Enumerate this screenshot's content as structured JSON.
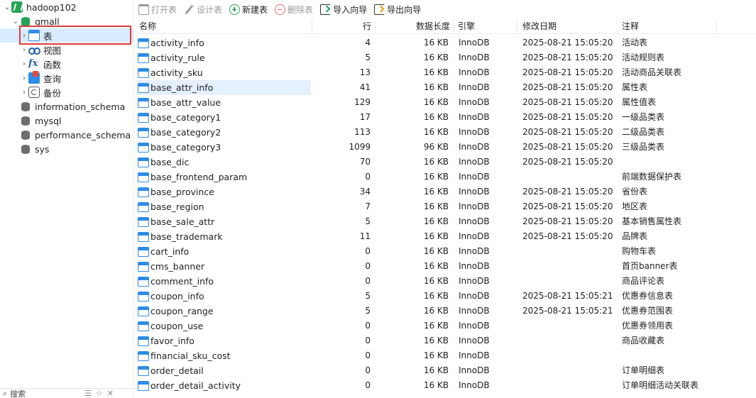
{
  "sidebar": {
    "connection": "hadoop102",
    "database": "gmall",
    "items": [
      {
        "label": "表",
        "icon": "table-icon"
      },
      {
        "label": "视图",
        "icon": "view-icon"
      },
      {
        "label": "函数",
        "icon": "function-icon"
      },
      {
        "label": "查询",
        "icon": "query-icon"
      },
      {
        "label": "备份",
        "icon": "backup-icon"
      }
    ],
    "other_databases": [
      "information_schema",
      "mysql",
      "performance_schema",
      "sys"
    ],
    "search_label": "搜索"
  },
  "toolbar": {
    "open_table": "打开表",
    "design_table": "设计表",
    "new_table": "新建表",
    "delete_table": "删除表",
    "import_wizard": "导入向导",
    "export_wizard": "导出向导"
  },
  "table": {
    "columns": [
      "名称",
      "行",
      "数据长度",
      "引擎",
      "修改日期",
      "注释"
    ],
    "rows": [
      {
        "name": "activity_info",
        "rows": "4",
        "size": "16 KB",
        "engine": "InnoDB",
        "modified": "2025-08-21 15:05:20",
        "comment": "活动表"
      },
      {
        "name": "activity_rule",
        "rows": "5",
        "size": "16 KB",
        "engine": "InnoDB",
        "modified": "2025-08-21 15:05:20",
        "comment": "活动规则表"
      },
      {
        "name": "activity_sku",
        "rows": "13",
        "size": "16 KB",
        "engine": "InnoDB",
        "modified": "2025-08-21 15:05:20",
        "comment": "活动商品关联表"
      },
      {
        "name": "base_attr_info",
        "rows": "41",
        "size": "16 KB",
        "engine": "InnoDB",
        "modified": "2025-08-21 15:05:20",
        "comment": "属性表"
      },
      {
        "name": "base_attr_value",
        "rows": "129",
        "size": "16 KB",
        "engine": "InnoDB",
        "modified": "2025-08-21 15:05:20",
        "comment": "属性值表"
      },
      {
        "name": "base_category1",
        "rows": "17",
        "size": "16 KB",
        "engine": "InnoDB",
        "modified": "2025-08-21 15:05:20",
        "comment": "一级品类表"
      },
      {
        "name": "base_category2",
        "rows": "113",
        "size": "16 KB",
        "engine": "InnoDB",
        "modified": "2025-08-21 15:05:20",
        "comment": "二级品类表"
      },
      {
        "name": "base_category3",
        "rows": "1099",
        "size": "96 KB",
        "engine": "InnoDB",
        "modified": "2025-08-21 15:05:20",
        "comment": "三级品类表"
      },
      {
        "name": "base_dic",
        "rows": "70",
        "size": "16 KB",
        "engine": "InnoDB",
        "modified": "2025-08-21 15:05:20",
        "comment": ""
      },
      {
        "name": "base_frontend_param",
        "rows": "0",
        "size": "16 KB",
        "engine": "InnoDB",
        "modified": "",
        "comment": "前端数据保护表"
      },
      {
        "name": "base_province",
        "rows": "34",
        "size": "16 KB",
        "engine": "InnoDB",
        "modified": "2025-08-21 15:05:20",
        "comment": "省份表"
      },
      {
        "name": "base_region",
        "rows": "7",
        "size": "16 KB",
        "engine": "InnoDB",
        "modified": "2025-08-21 15:05:20",
        "comment": "地区表"
      },
      {
        "name": "base_sale_attr",
        "rows": "5",
        "size": "16 KB",
        "engine": "InnoDB",
        "modified": "2025-08-21 15:05:20",
        "comment": "基本销售属性表"
      },
      {
        "name": "base_trademark",
        "rows": "11",
        "size": "16 KB",
        "engine": "InnoDB",
        "modified": "2025-08-21 15:05:20",
        "comment": "品牌表"
      },
      {
        "name": "cart_info",
        "rows": "0",
        "size": "16 KB",
        "engine": "InnoDB",
        "modified": "",
        "comment": "购物车表"
      },
      {
        "name": "cms_banner",
        "rows": "0",
        "size": "16 KB",
        "engine": "InnoDB",
        "modified": "",
        "comment": "首页banner表"
      },
      {
        "name": "comment_info",
        "rows": "0",
        "size": "16 KB",
        "engine": "InnoDB",
        "modified": "",
        "comment": "商品评论表"
      },
      {
        "name": "coupon_info",
        "rows": "5",
        "size": "16 KB",
        "engine": "InnoDB",
        "modified": "2025-08-21 15:05:21",
        "comment": "优惠券信息表"
      },
      {
        "name": "coupon_range",
        "rows": "5",
        "size": "16 KB",
        "engine": "InnoDB",
        "modified": "2025-08-21 15:05:21",
        "comment": "优惠券范围表"
      },
      {
        "name": "coupon_use",
        "rows": "0",
        "size": "16 KB",
        "engine": "InnoDB",
        "modified": "",
        "comment": "优惠券领用表"
      },
      {
        "name": "favor_info",
        "rows": "0",
        "size": "16 KB",
        "engine": "InnoDB",
        "modified": "",
        "comment": "商品收藏表"
      },
      {
        "name": "financial_sku_cost",
        "rows": "0",
        "size": "16 KB",
        "engine": "InnoDB",
        "modified": "",
        "comment": ""
      },
      {
        "name": "order_detail",
        "rows": "0",
        "size": "16 KB",
        "engine": "InnoDB",
        "modified": "",
        "comment": "订单明细表"
      },
      {
        "name": "order_detail_activity",
        "rows": "0",
        "size": "16 KB",
        "engine": "InnoDB",
        "modified": "",
        "comment": "订单明细活动关联表"
      }
    ]
  },
  "colors": {
    "accent_blue": "#2d8ce6",
    "connection_green": "#22a455",
    "selection_bg": "#d9ebff",
    "highlight_red": "#e03a3a"
  }
}
